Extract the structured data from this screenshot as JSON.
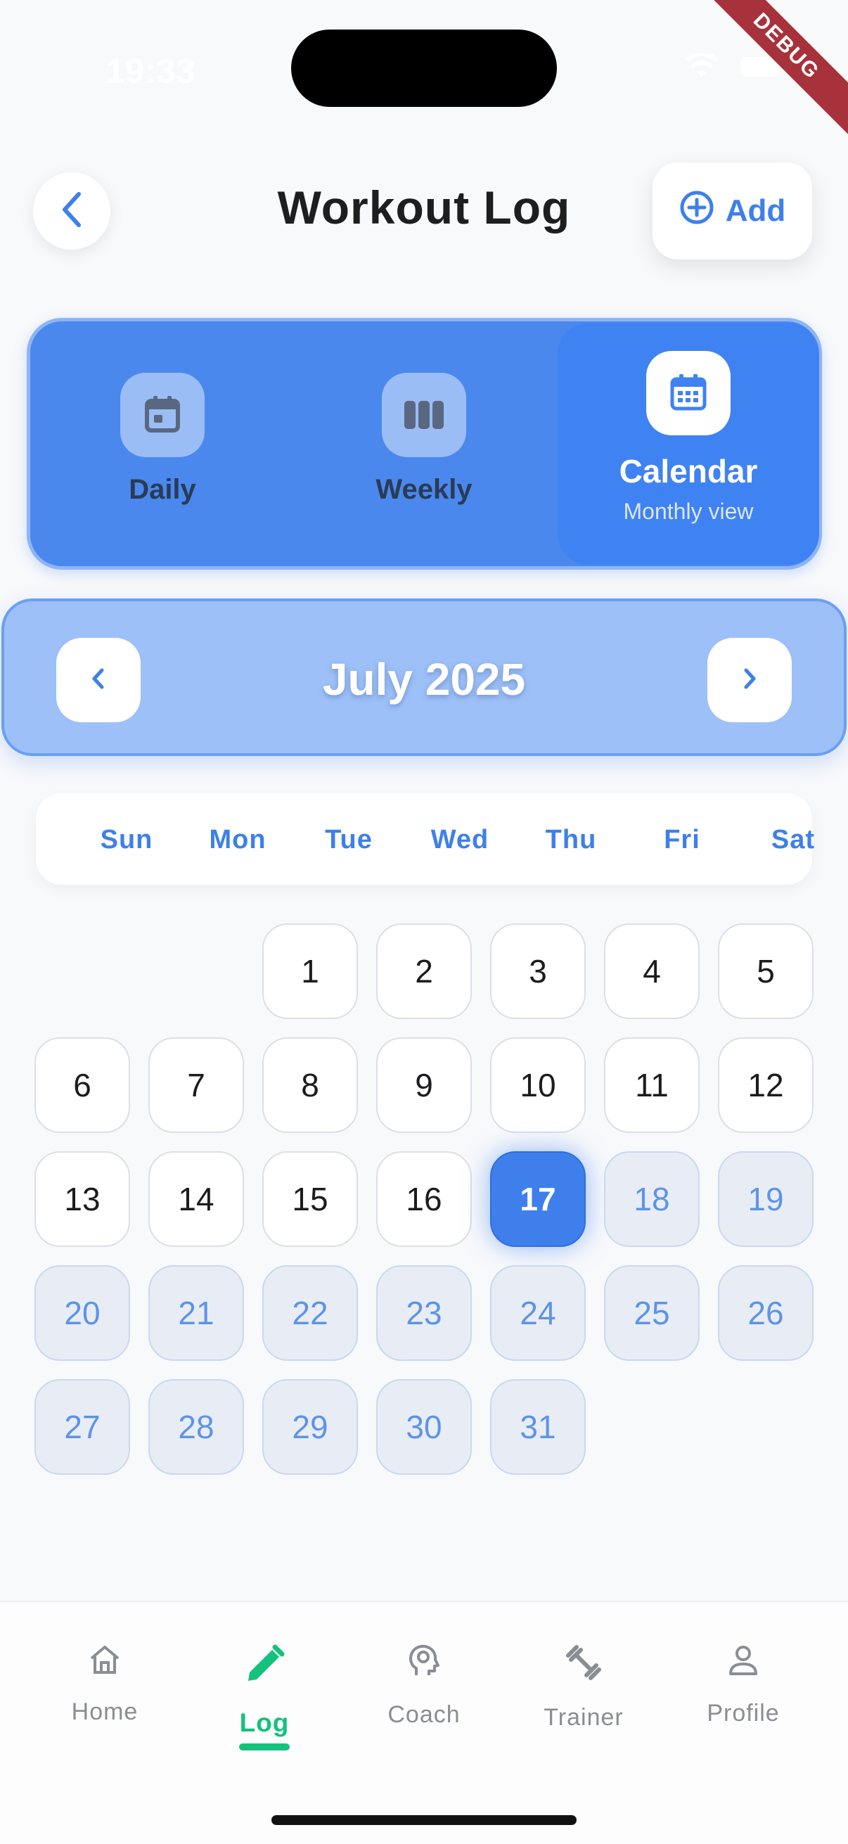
{
  "status_bar": {
    "time": "19:33"
  },
  "debug_banner": "DEBUG",
  "header": {
    "title": "Workout Log",
    "add_label": "Add"
  },
  "view_tabs": [
    {
      "label": "Daily",
      "icon": "calendar-day-icon"
    },
    {
      "label": "Weekly",
      "icon": "week-columns-icon"
    },
    {
      "label": "Calendar",
      "subtitle": "Monthly view",
      "icon": "calendar-month-icon",
      "active": true
    }
  ],
  "month_nav": {
    "title": "July 2025"
  },
  "weekdays": [
    "Sun",
    "Mon",
    "Tue",
    "Wed",
    "Thu",
    "Fri",
    "Sat"
  ],
  "calendar": {
    "first_weekday_index": 2,
    "days_in_month": 31,
    "today": 17,
    "days": [
      "1",
      "2",
      "3",
      "4",
      "5",
      "6",
      "7",
      "8",
      "9",
      "10",
      "11",
      "12",
      "13",
      "14",
      "15",
      "16",
      "17",
      "18",
      "19",
      "20",
      "21",
      "22",
      "23",
      "24",
      "25",
      "26",
      "27",
      "28",
      "29",
      "30",
      "31"
    ]
  },
  "colors": {
    "accent": "#3f7fec",
    "active_nav": "#14c27c",
    "future_day_text": "#5e93e8"
  },
  "bottom_nav": [
    {
      "label": "Home",
      "icon": "home-icon"
    },
    {
      "label": "Log",
      "icon": "pencil-icon",
      "active": true
    },
    {
      "label": "Coach",
      "icon": "brain-head-icon"
    },
    {
      "label": "Trainer",
      "icon": "dumbbell-icon"
    },
    {
      "label": "Profile",
      "icon": "person-icon"
    }
  ]
}
